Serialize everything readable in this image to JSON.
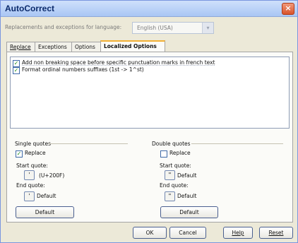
{
  "window": {
    "title": "AutoCorrect"
  },
  "language": {
    "label": "Replacements and exceptions for language:",
    "value": "English (USA)"
  },
  "tabs": [
    "Replace",
    "Exceptions",
    "Options",
    "Localized Options"
  ],
  "options": [
    {
      "label": "Add non breaking space before specific punctuation marks in french text",
      "checked": true
    },
    {
      "label": "Format ordinal numbers suffixes (1st -> 1^st)",
      "checked": true
    }
  ],
  "single_quotes": {
    "heading": "Single quotes",
    "replace_label": "Replace",
    "replace_checked": true,
    "start_label": "Start quote:",
    "start_char": "'",
    "start_value": "(U+200F)",
    "end_label": "End quote:",
    "end_char": "'",
    "end_value": "Default",
    "default_button": "Default"
  },
  "double_quotes": {
    "heading": "Double quotes",
    "replace_label": "Replace",
    "replace_checked": false,
    "start_label": "Start quote:",
    "start_char": "\"",
    "start_value": "Default",
    "end_label": "End quote:",
    "end_char": "\"",
    "end_value": "Default",
    "default_button": "Default"
  },
  "buttons": {
    "ok": "OK",
    "cancel": "Cancel",
    "help": "Help",
    "reset": "Reset"
  }
}
